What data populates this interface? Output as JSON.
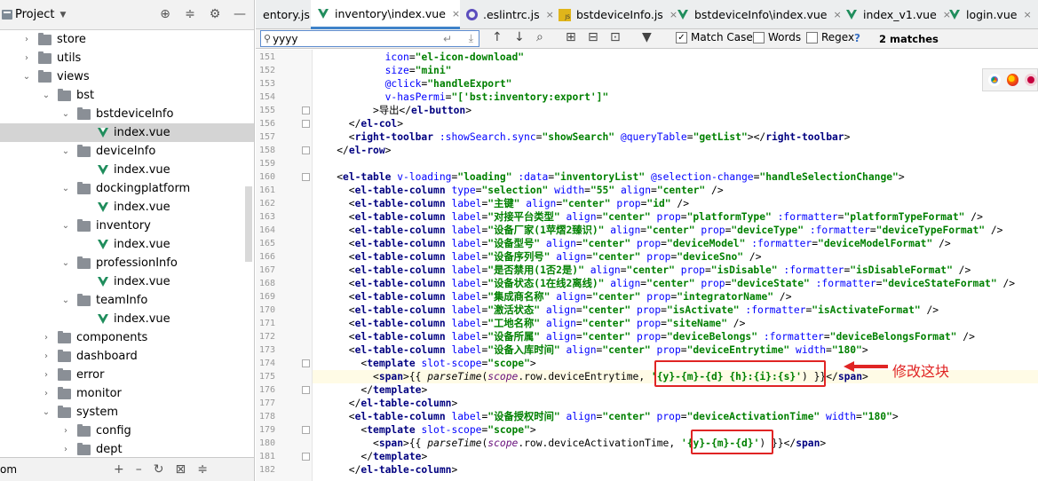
{
  "project_panel": {
    "title": "Project",
    "dropdown": "▼",
    "tools": [
      "⊕",
      "≑",
      "⚙",
      "—"
    ],
    "tree": [
      {
        "label": "store",
        "chev": "›",
        "kind": "folder",
        "indent": 1
      },
      {
        "label": "utils",
        "chev": "›",
        "kind": "folder",
        "indent": 1
      },
      {
        "label": "views",
        "chev": "⌄",
        "kind": "folder",
        "indent": 1
      },
      {
        "label": "bst",
        "chev": "⌄",
        "kind": "folder",
        "indent": 2
      },
      {
        "label": "bstdeviceInfo",
        "chev": "⌄",
        "kind": "folder",
        "indent": 3
      },
      {
        "label": "index.vue",
        "chev": "",
        "kind": "vue",
        "indent": 4,
        "selected": true
      },
      {
        "label": "deviceInfo",
        "chev": "⌄",
        "kind": "folder",
        "indent": 3
      },
      {
        "label": "index.vue",
        "chev": "",
        "kind": "vue",
        "indent": 4
      },
      {
        "label": "dockingplatform",
        "chev": "⌄",
        "kind": "folder",
        "indent": 3
      },
      {
        "label": "index.vue",
        "chev": "",
        "kind": "vue",
        "indent": 4
      },
      {
        "label": "inventory",
        "chev": "⌄",
        "kind": "folder",
        "indent": 3
      },
      {
        "label": "index.vue",
        "chev": "",
        "kind": "vue",
        "indent": 4
      },
      {
        "label": "professionInfo",
        "chev": "⌄",
        "kind": "folder",
        "indent": 3
      },
      {
        "label": "index.vue",
        "chev": "",
        "kind": "vue",
        "indent": 4
      },
      {
        "label": "teamInfo",
        "chev": "⌄",
        "kind": "folder",
        "indent": 3
      },
      {
        "label": "index.vue",
        "chev": "",
        "kind": "vue",
        "indent": 4
      },
      {
        "label": "components",
        "chev": "›",
        "kind": "folder",
        "indent": 2
      },
      {
        "label": "dashboard",
        "chev": "›",
        "kind": "folder",
        "indent": 2
      },
      {
        "label": "error",
        "chev": "›",
        "kind": "folder",
        "indent": 2
      },
      {
        "label": "monitor",
        "chev": "›",
        "kind": "folder",
        "indent": 2
      },
      {
        "label": "system",
        "chev": "⌄",
        "kind": "folder",
        "indent": 2
      },
      {
        "label": "config",
        "chev": "›",
        "kind": "folder",
        "indent": 3
      },
      {
        "label": "dept",
        "chev": "›",
        "kind": "folder",
        "indent": 3
      }
    ],
    "bottom_text": "om",
    "bottom_tools": [
      "+",
      "–",
      "↻",
      "⊠",
      "≑"
    ]
  },
  "tabs": [
    {
      "label": "entory.js",
      "icon": "js",
      "active": false
    },
    {
      "label": "inventory\\index.vue",
      "icon": "vue",
      "active": true
    },
    {
      "label": ".eslintrc.js",
      "icon": "eslint",
      "active": false
    },
    {
      "label": "bstdeviceInfo.js",
      "icon": "js",
      "active": false
    },
    {
      "label": "bstdeviceInfo\\index.vue",
      "icon": "vue",
      "active": false
    },
    {
      "label": "index_v1.vue",
      "icon": "vue",
      "active": false
    },
    {
      "label": "login.vue",
      "icon": "vue",
      "active": false
    }
  ],
  "tab_close": "×",
  "search": {
    "query": "yyyy",
    "placeholder": "",
    "options": [
      {
        "label": "Match Case",
        "checked": true
      },
      {
        "label": "Words",
        "checked": false
      },
      {
        "label": "Regex",
        "checked": false
      }
    ],
    "help": "?",
    "match_count": "2 matches"
  },
  "code_lines": [
    {
      "n": "151",
      "html": "            <span class=\"a\">icon</span>=<span class=\"s\">\"el-icon-download\"</span>"
    },
    {
      "n": "152",
      "html": "            <span class=\"a\">size</span>=<span class=\"s\">\"mini\"</span>"
    },
    {
      "n": "153",
      "html": "            <span class=\"a\">@click</span>=<span class=\"s\">\"handleExport\"</span>"
    },
    {
      "n": "154",
      "html": "            <span class=\"a\">v-hasPermi</span>=<span class=\"s\">\"['bst:inventory:export']\"</span>"
    },
    {
      "n": "155",
      "html": "          &gt;导出&lt;/<span class=\"t\">el-button</span>&gt;"
    },
    {
      "n": "156",
      "html": "      &lt;/<span class=\"t\">el-col</span>&gt;"
    },
    {
      "n": "157",
      "html": "      &lt;<span class=\"t\">right-toolbar</span> <span class=\"a\">:showSearch.sync</span>=<span class=\"s\">\"showSearch\"</span> <span class=\"a\">@queryTable</span>=<span class=\"s\">\"getList\"</span>&gt;&lt;/<span class=\"t\">right-toolbar</span>&gt;"
    },
    {
      "n": "158",
      "html": "    &lt;/<span class=\"t\">el-row</span>&gt;"
    },
    {
      "n": "159",
      "html": ""
    },
    {
      "n": "160",
      "html": "    &lt;<span class=\"t\">el-table</span> <span class=\"a\">v-loading</span>=<span class=\"s\">\"loading\"</span> <span class=\"a\">:data</span>=<span class=\"s\">\"inventoryList\"</span> <span class=\"a\">@selection-change</span>=<span class=\"s\">\"handleSelectionChange\"</span>&gt;"
    },
    {
      "n": "161",
      "html": "      &lt;<span class=\"t\">el-table-column</span> <span class=\"a\">type</span>=<span class=\"s\">\"selection\"</span> <span class=\"a\">width</span>=<span class=\"s\">\"55\"</span> <span class=\"a\">align</span>=<span class=\"s\">\"center\"</span> /&gt;"
    },
    {
      "n": "162",
      "html": "      &lt;<span class=\"t\">el-table-column</span> <span class=\"a\">label</span>=<span class=\"s\">\"主键\"</span> <span class=\"a\">align</span>=<span class=\"s\">\"center\"</span> <span class=\"a\">prop</span>=<span class=\"s\">\"id\"</span> /&gt;"
    },
    {
      "n": "163",
      "html": "      &lt;<span class=\"t\">el-table-column</span> <span class=\"a\">label</span>=<span class=\"s\">\"对接平台类型\"</span> <span class=\"a\">align</span>=<span class=\"s\">\"center\"</span> <span class=\"a\">prop</span>=<span class=\"s\">\"platformType\"</span> <span class=\"a\">:formatter</span>=<span class=\"s\">\"platformTypeFormat\"</span> /&gt;"
    },
    {
      "n": "164",
      "html": "      &lt;<span class=\"t\">el-table-column</span> <span class=\"a\">label</span>=<span class=\"s\">\"设备厂家(1苹熠2臻识)\"</span> <span class=\"a\">align</span>=<span class=\"s\">\"center\"</span> <span class=\"a\">prop</span>=<span class=\"s\">\"deviceType\"</span> <span class=\"a\">:formatter</span>=<span class=\"s\">\"deviceTypeFormat\"</span> /&gt;"
    },
    {
      "n": "165",
      "html": "      &lt;<span class=\"t\">el-table-column</span> <span class=\"a\">label</span>=<span class=\"s\">\"设备型号\"</span> <span class=\"a\">align</span>=<span class=\"s\">\"center\"</span> <span class=\"a\">prop</span>=<span class=\"s\">\"deviceModel\"</span> <span class=\"a\">:formatter</span>=<span class=\"s\">\"deviceModelFormat\"</span> /&gt;"
    },
    {
      "n": "166",
      "html": "      &lt;<span class=\"t\">el-table-column</span> <span class=\"a\">label</span>=<span class=\"s\">\"设备序列号\"</span> <span class=\"a\">align</span>=<span class=\"s\">\"center\"</span> <span class=\"a\">prop</span>=<span class=\"s\">\"deviceSno\"</span> /&gt;"
    },
    {
      "n": "167",
      "html": "      &lt;<span class=\"t\">el-table-column</span> <span class=\"a\">label</span>=<span class=\"s\">\"是否禁用(1否2是)\"</span> <span class=\"a\">align</span>=<span class=\"s\">\"center\"</span> <span class=\"a\">prop</span>=<span class=\"s\">\"isDisable\"</span> <span class=\"a\">:formatter</span>=<span class=\"s\">\"isDisableFormat\"</span> /&gt;"
    },
    {
      "n": "168",
      "html": "      &lt;<span class=\"t\">el-table-column</span> <span class=\"a\">label</span>=<span class=\"s\">\"设备状态(1在线2离线)\"</span> <span class=\"a\">align</span>=<span class=\"s\">\"center\"</span> <span class=\"a\">prop</span>=<span class=\"s\">\"deviceState\"</span> <span class=\"a\">:formatter</span>=<span class=\"s\">\"deviceStateFormat\"</span> /&gt;"
    },
    {
      "n": "169",
      "html": "      &lt;<span class=\"t\">el-table-column</span> <span class=\"a\">label</span>=<span class=\"s\">\"集成商名称\"</span> <span class=\"a\">align</span>=<span class=\"s\">\"center\"</span> <span class=\"a\">prop</span>=<span class=\"s\">\"integratorName\"</span> /&gt;"
    },
    {
      "n": "170",
      "html": "      &lt;<span class=\"t\">el-table-column</span> <span class=\"a\">label</span>=<span class=\"s\">\"激活状态\"</span> <span class=\"a\">align</span>=<span class=\"s\">\"center\"</span> <span class=\"a\">prop</span>=<span class=\"s\">\"isActivate\"</span> <span class=\"a\">:formatter</span>=<span class=\"s\">\"isActivateFormat\"</span> /&gt;"
    },
    {
      "n": "171",
      "html": "      &lt;<span class=\"t\">el-table-column</span> <span class=\"a\">label</span>=<span class=\"s\">\"工地名称\"</span> <span class=\"a\">align</span>=<span class=\"s\">\"center\"</span> <span class=\"a\">prop</span>=<span class=\"s\">\"siteName\"</span> /&gt;"
    },
    {
      "n": "172",
      "html": "      &lt;<span class=\"t\">el-table-column</span> <span class=\"a\">label</span>=<span class=\"s\">\"设备所属\"</span> <span class=\"a\">align</span>=<span class=\"s\">\"center\"</span> <span class=\"a\">prop</span>=<span class=\"s\">\"deviceBelongs\"</span> <span class=\"a\">:formatter</span>=<span class=\"s\">\"deviceBelongsFormat\"</span> /&gt;"
    },
    {
      "n": "173",
      "html": "      &lt;<span class=\"t\">el-table-column</span> <span class=\"a\">label</span>=<span class=\"s\">\"设备入库时间\"</span> <span class=\"a\">align</span>=<span class=\"s\">\"center\"</span> <span class=\"a\">prop</span>=<span class=\"s\">\"deviceEntrytime\"</span> <span class=\"a\">width</span>=<span class=\"s\">\"180\"</span>&gt;"
    },
    {
      "n": "174",
      "html": "        &lt;<span class=\"t\">template</span> <span class=\"a\">slot-scope</span>=<span class=\"s\">\"scope\"</span>&gt;"
    },
    {
      "n": "175",
      "html": "          &lt;<span class=\"t\">span</span>&gt;{{ <span class=\"f\">parseTime</span>(<span class=\"v\">scope</span>.row.deviceEntrytime, <span class=\"s\">'{y}-{m}-{d} {h}:{i}:{s}'</span>) }}&lt;/<span class=\"t\">span</span>&gt;",
      "current": true
    },
    {
      "n": "176",
      "html": "        &lt;/<span class=\"t\">template</span>&gt;"
    },
    {
      "n": "177",
      "html": "      &lt;/<span class=\"t\">el-table-column</span>&gt;"
    },
    {
      "n": "178",
      "html": "      &lt;<span class=\"t\">el-table-column</span> <span class=\"a\">label</span>=<span class=\"s\">\"设备授权时间\"</span> <span class=\"a\">align</span>=<span class=\"s\">\"center\"</span> <span class=\"a\">prop</span>=<span class=\"s\">\"deviceActivationTime\"</span> <span class=\"a\">width</span>=<span class=\"s\">\"180\"</span>&gt;"
    },
    {
      "n": "179",
      "html": "        &lt;<span class=\"t\">template</span> <span class=\"a\">slot-scope</span>=<span class=\"s\">\"scope\"</span>&gt;"
    },
    {
      "n": "180",
      "html": "          &lt;<span class=\"t\">span</span>&gt;{{ <span class=\"f\">parseTime</span>(<span class=\"v\">scope</span>.row.deviceActivationTime, <span class=\"s\">'{y}-{m}-{d}'</span>) }}&lt;/<span class=\"t\">span</span>&gt;"
    },
    {
      "n": "181",
      "html": "        &lt;/<span class=\"t\">template</span>&gt;"
    },
    {
      "n": "182",
      "html": "      &lt;/<span class=\"t\">el-table-column</span>&gt;"
    }
  ],
  "annotation": {
    "text": "修改这块",
    "color": "#e02424"
  },
  "colors": {
    "accent": "#4083c9",
    "vue_green": "#1f8d5c"
  }
}
